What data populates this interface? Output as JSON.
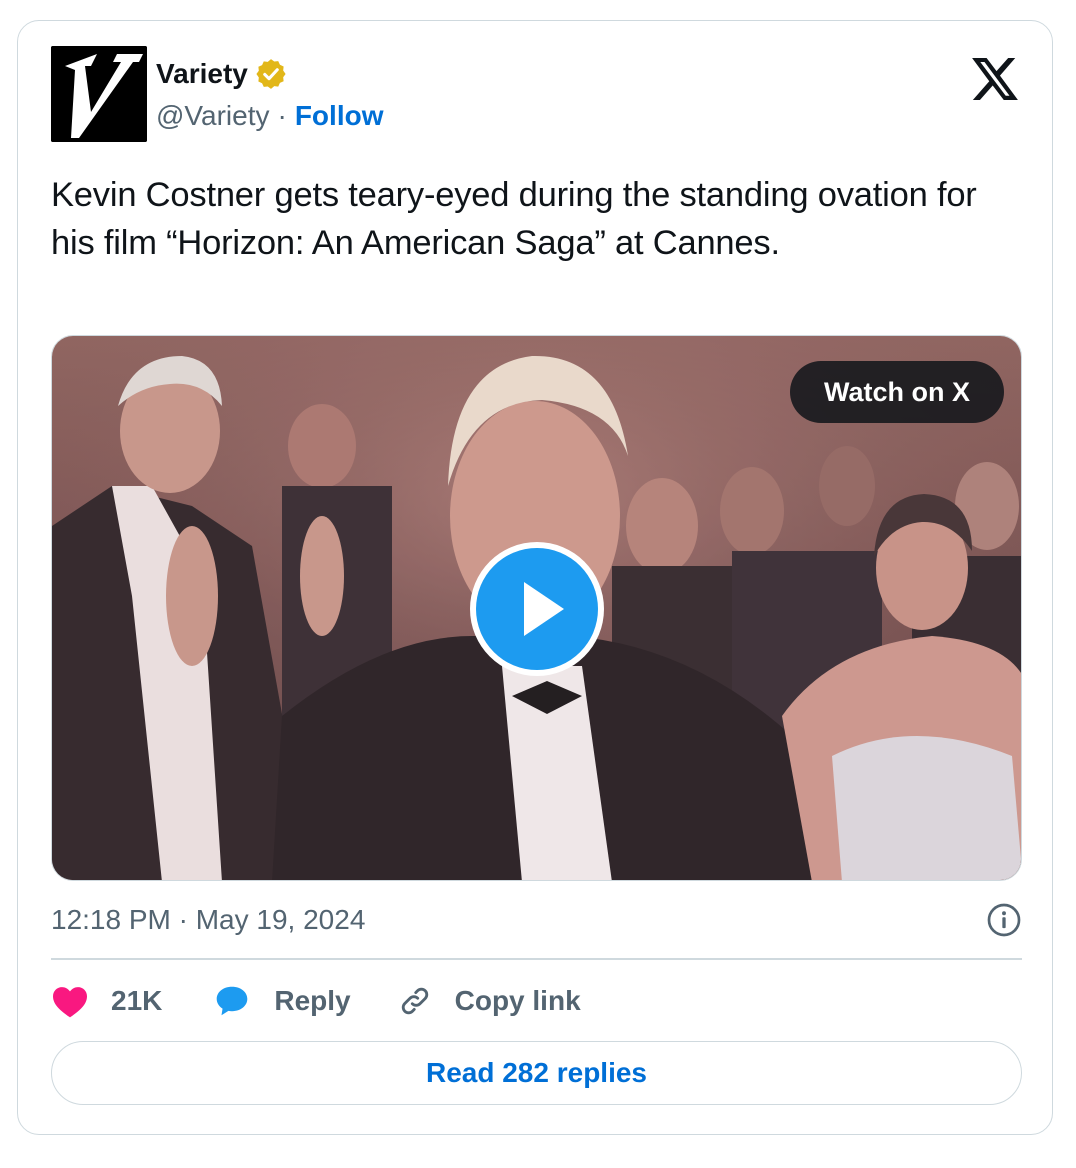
{
  "author": {
    "name": "Variety",
    "handle": "@Variety",
    "separator": "·",
    "follow_label": "Follow",
    "avatar_icon": "variety-v-logo",
    "verified_icon": "verified-gold-badge-icon",
    "verified_color": "#e2b719"
  },
  "platform_icon": "x-logo-icon",
  "tweet": {
    "text": "Kevin Costner gets teary-eyed during the standing ovation for his film “Horizon: An American Saga” at Cannes."
  },
  "media": {
    "type": "video",
    "watch_label": "Watch on X",
    "play_icon": "play-icon",
    "play_color": "#1d9bf0"
  },
  "meta": {
    "timestamp": "12:18 PM · May 19, 2024",
    "info_icon": "info-icon"
  },
  "actions": {
    "like": {
      "icon": "heart-icon",
      "label": "21K",
      "color": "#f91880"
    },
    "reply": {
      "icon": "speech-bubble-icon",
      "label": "Reply",
      "color": "#1d9bf0"
    },
    "copy": {
      "icon": "link-icon",
      "label": "Copy link"
    }
  },
  "read_replies_label": "Read 282 replies",
  "colors": {
    "link_blue": "#006fd6",
    "secondary_text": "#536471",
    "border": "#cfd9de"
  }
}
